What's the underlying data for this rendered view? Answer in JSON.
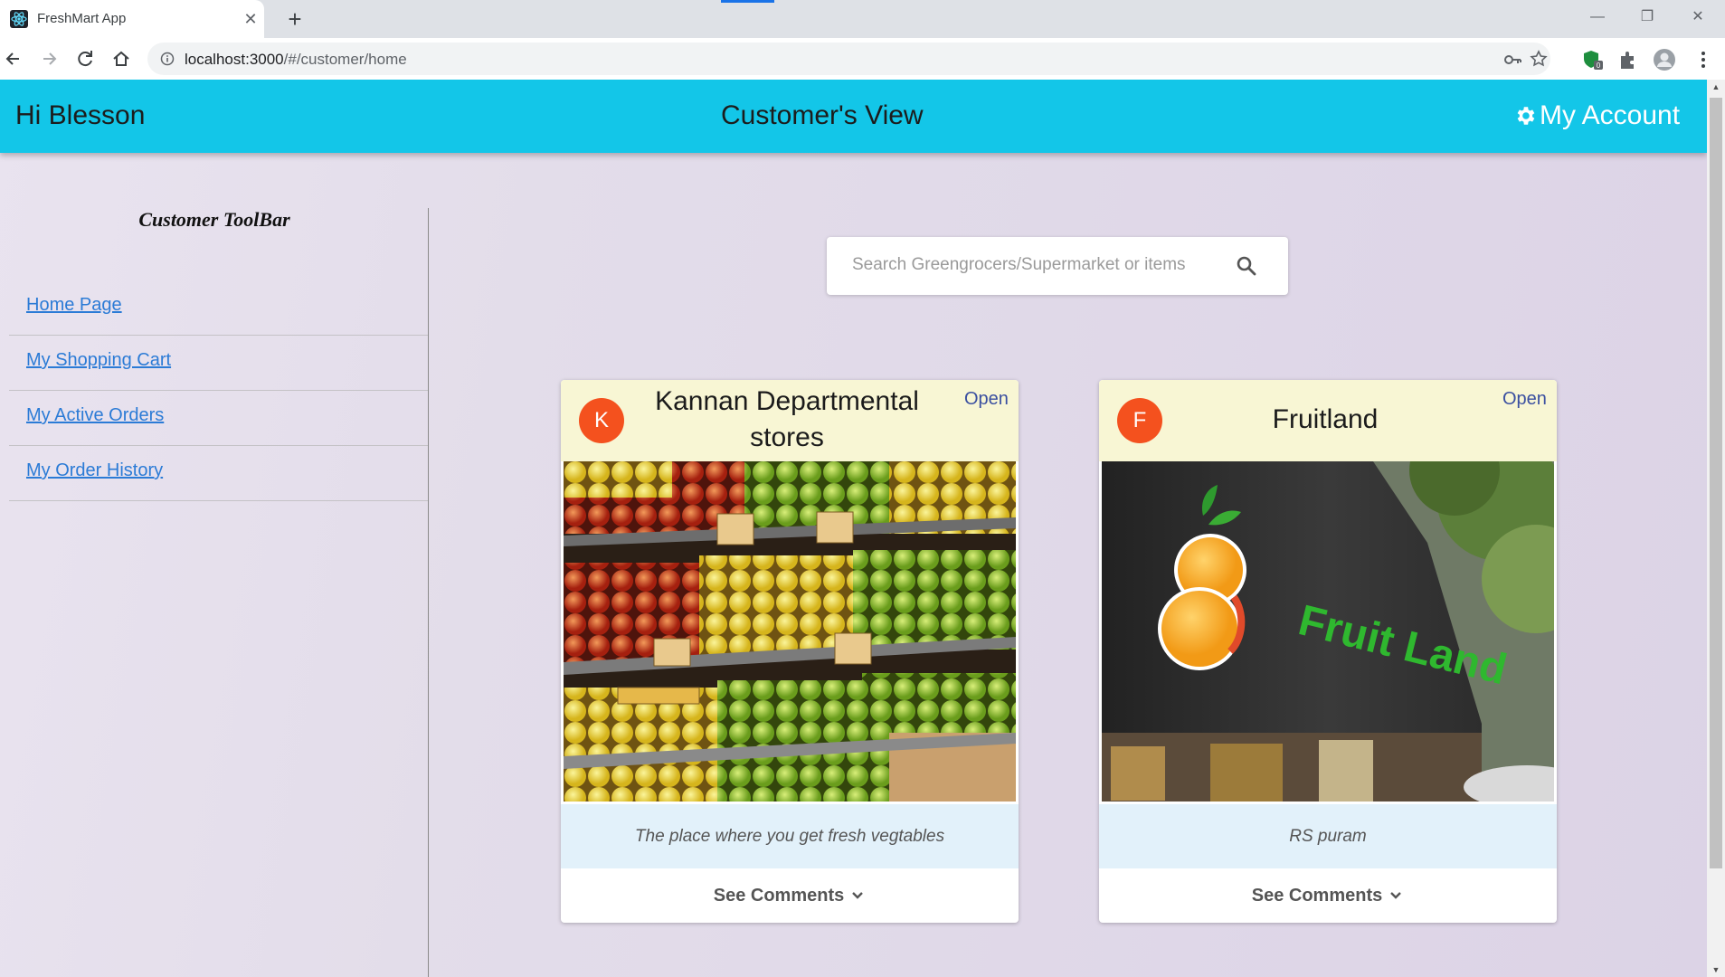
{
  "browser": {
    "tab_title": "FreshMart App",
    "tab_close": "✕",
    "new_tab": "+",
    "url_host": "localhost:3000",
    "url_path": "/#/customer/home",
    "window_controls": {
      "minimize": "—",
      "restore": "❐",
      "close": "✕"
    }
  },
  "header": {
    "greeting": "Hi Blesson",
    "title": "Customer's View",
    "account_label": "My Account"
  },
  "sidebar": {
    "title": "Customer ToolBar",
    "items": [
      {
        "label": "Home Page"
      },
      {
        "label": "My Shopping Cart"
      },
      {
        "label": "My Active Orders"
      },
      {
        "label": "My Order History"
      }
    ]
  },
  "search": {
    "placeholder": "Search Greengrocers/Supermarket or items",
    "value": ""
  },
  "stores": [
    {
      "initial": "K",
      "name": "Kannan Departmental stores",
      "status": "Open",
      "description": "The place where you get fresh vegtables",
      "comments_label": "See Comments"
    },
    {
      "initial": "F",
      "name": "Fruitland",
      "status": "Open",
      "description": "RS puram",
      "comments_label": "See Comments",
      "sign_text": "Fruit Land"
    }
  ],
  "colors": {
    "header": "#13c6e8",
    "avatar": "#f4511e",
    "card_head": "#f8f6d4",
    "card_desc": "#e2f1fa",
    "link": "#2b7bd6"
  }
}
